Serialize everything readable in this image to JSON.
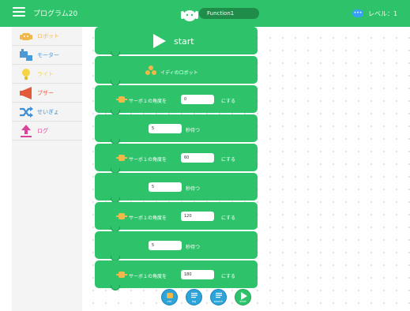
{
  "header": {
    "title": "プログラム20",
    "function_tab": "Function1",
    "dots_badge": "•••",
    "level": "レベル：1"
  },
  "sidebar": {
    "items": [
      {
        "label": "ロボット",
        "color": "#f0b84a",
        "icon": "robot-icon"
      },
      {
        "label": "モーター",
        "color": "#4a9ad8",
        "icon": "motor-icon"
      },
      {
        "label": "ライト",
        "color": "#f5d445",
        "icon": "light-bulb-icon"
      },
      {
        "label": "ブザー",
        "color": "#e35a3a",
        "icon": "buzzer-icon"
      },
      {
        "label": "せいぎょ",
        "color": "#3a8fd6",
        "icon": "control-shuffle-icon"
      },
      {
        "label": "ログ",
        "color": "#d9449a",
        "icon": "log-upload-icon"
      }
    ]
  },
  "blocks": {
    "start": "start",
    "robot": "イディのロボット",
    "servo1": {
      "prefix": "サーボ１の角度を",
      "value": "0",
      "suffix": "にする"
    },
    "wait1": {
      "value": "5",
      "suffix": "秒待つ"
    },
    "servo2": {
      "prefix": "サーボ１の角度を",
      "value": "60",
      "suffix": "にする"
    },
    "wait2": {
      "value": "5",
      "suffix": "秒待つ"
    },
    "servo3": {
      "prefix": "サーボ１の角度を",
      "value": "120",
      "suffix": "にする"
    },
    "wait3": {
      "value": "5",
      "suffix": "秒待つ"
    },
    "servo4": {
      "prefix": "サーボ１の角度を",
      "value": "180",
      "suffix": "にする"
    }
  },
  "bottom_buttons": [
    {
      "label": "ctrl",
      "icon": "robot-face-icon"
    },
    {
      "label": "log",
      "icon": "log-document-icon"
    },
    {
      "label": "search",
      "icon": "search-document-icon"
    },
    {
      "label": "start",
      "icon": "play-icon"
    }
  ],
  "colors": {
    "brand_green": "#2ec36a",
    "tab_dark_green": "#1f8c4a",
    "button_blue": "#2ea3d8"
  }
}
